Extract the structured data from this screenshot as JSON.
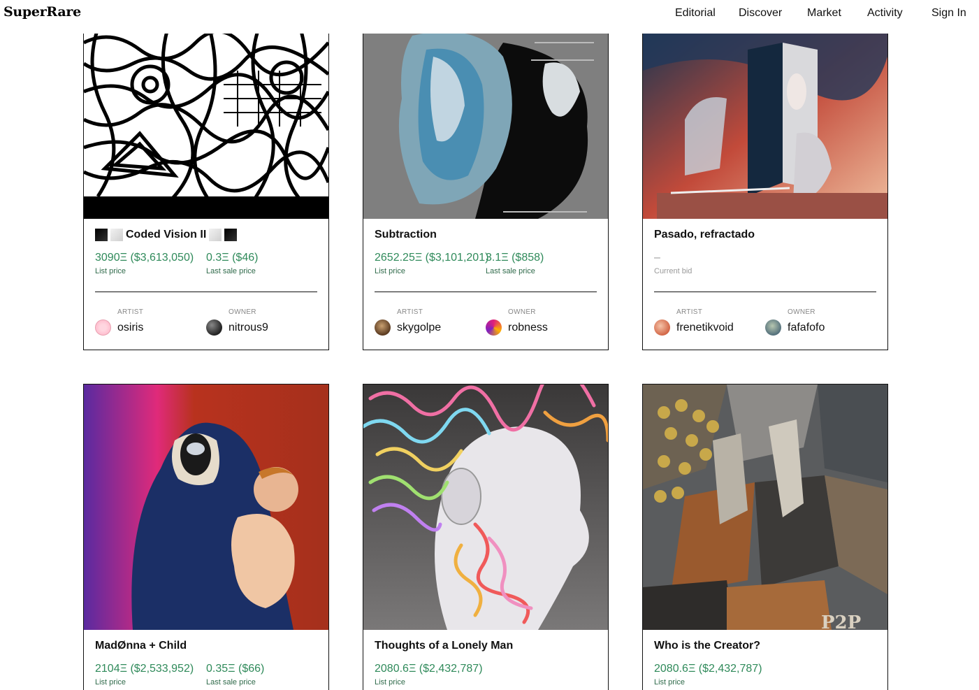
{
  "header": {
    "logo": "SuperRare",
    "nav": [
      {
        "label": "Editorial"
      },
      {
        "label": "Discover"
      },
      {
        "label": "Market"
      },
      {
        "label": "Activity"
      },
      {
        "label": "Sign In"
      }
    ]
  },
  "cards": [
    {
      "title": "Coded Vision II",
      "price1": "3090Ξ ($3,613,050)",
      "price1_label": "List price",
      "price2": "0.3Ξ ($46)",
      "price2_label": "Last sale price",
      "artist_label": "ARTIST",
      "artist": "osiris",
      "owner_label": "OWNER",
      "owner": "nitrous9"
    },
    {
      "title": "Subtraction",
      "price1": "2652.25Ξ ($3,101,201)",
      "price1_label": "List price",
      "price2": "3.1Ξ ($858)",
      "price2_label": "Last sale price",
      "artist_label": "ARTIST",
      "artist": "skygolpe",
      "owner_label": "OWNER",
      "owner": "robness"
    },
    {
      "title": "Pasado, refractado",
      "price1": "–",
      "price1_label": "Current bid",
      "artist_label": "ARTIST",
      "artist": "frenetikvoid",
      "owner_label": "OWNER",
      "owner": "fafafofo"
    },
    {
      "title": "MadØnna + Child",
      "price1": "2104Ξ ($2,533,952)",
      "price1_label": "List price",
      "price2": "0.35Ξ ($66)",
      "price2_label": "Last sale price"
    },
    {
      "title": "Thoughts of a Lonely Man",
      "price1": "2080.6Ξ ($2,432,787)",
      "price1_label": "List price"
    },
    {
      "title": "Who is the Creator?",
      "price1": "2080.6Ξ ($2,432,787)",
      "price1_label": "List price",
      "art_text": "P2P"
    }
  ],
  "colors": {
    "price_green": "#2f8a5a",
    "border": "#111111"
  }
}
